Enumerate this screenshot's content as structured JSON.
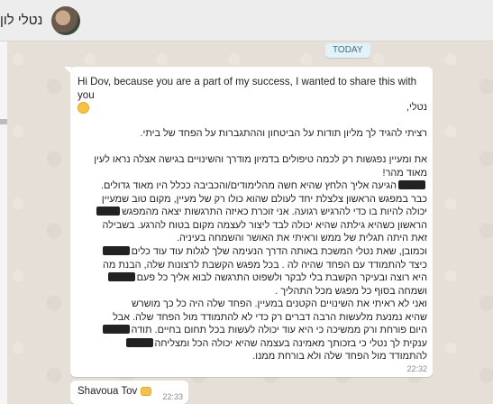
{
  "header": {
    "contact_name": "נטלי לון",
    "avatar_icon": "profile-photo"
  },
  "chat": {
    "date_chip": "TODAY",
    "message_1": {
      "greeting": "Hi Dov, because you are a part of my success, I wanted to share this with you",
      "greeting_emoji": "smiling-face-icon",
      "lines": [
        "נטלי,",
        "",
        "רציתי להגיד לך מליון תודות על הביטחון וההתגברות על הפחד של ביתי.",
        "",
        "את ומעיין נפגשות רק לכמה טיפולים בדמיון מודרך והשינויים בגישה אצלה נראו לעין",
        "מאוד מהר!",
        "הגיעה אליך הלחץ שהיא חשה מהלימודים/והכביבה ככלל היו מאוד גדולים.",
        "כבר במפגש הראשון צלצלת יחד לעולם שהוא כולו רק של מעיין, מקום טוב שמעיין",
        "יכולה להיות בו כדי להרגיש רגועה. אני זוכרת כאיזה התרגשות יצאה מהמפגש",
        "הראשון כשהיא גילתה שהיא יכולה לבד ליצור לעצמה מקום בטוח להרגע. בשבילה",
        "זאת היתה תגלית של ממש וראיתי את האושר והשמחה בעיניה.",
        "וכמובן, שאת נטלי המשכת באותה הדרך הנעימה שלך לגלות עוד עוד כלים",
        "כיצד להתמודד עם הפחד שהיה לה . בכל מפגש הקשבת לרצונות שלה, הבנת מה",
        "היא רוצה ובעיקר הקשבת בלי לבקר ולשפוט התרגשה לבוא אליך כל פעם",
        "ושמחה בסוף כל מפגש מכל התהליך .",
        "ואני לא ראיתי את השינויים הקטנים במעיין. הפחד שלה היה כל כך מושרש",
        "שהיא נמנעת מלעשות הרבה דברים רק כדי לא להתמודד מול הפחד שלה. אבל",
        "היום פורחת ורק ממשיכה כי היא עוד יכולה לעשות בכל תחום בחיים. תודה",
        "ענקית לך נטלי כי בזכותך מאמינה בעצמה שהיא יכולה הכל ומצליחה",
        "להתמודד מול הפחד שלה ולא בורחת ממנו."
      ],
      "time": "22:32"
    },
    "message_2": {
      "text": "Shavoua Tov",
      "emoji": "bouquet-icon",
      "time": "22:33"
    }
  }
}
